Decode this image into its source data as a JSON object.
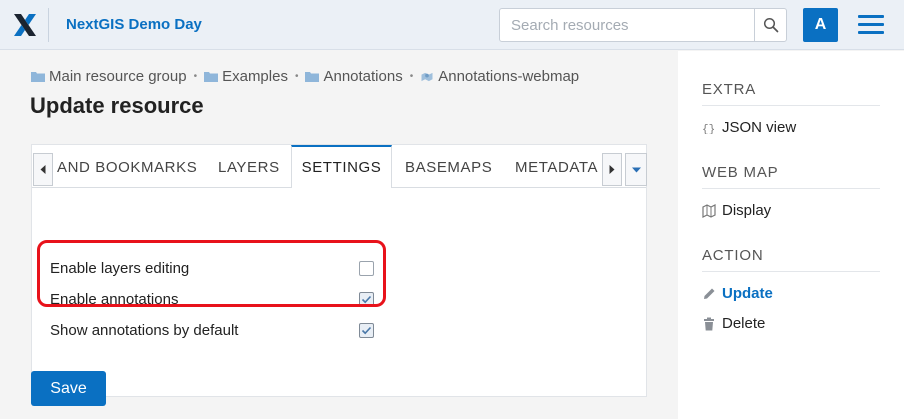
{
  "header": {
    "app_title": "NextGIS Demo Day",
    "search_placeholder": "Search resources",
    "avatar_letter": "A"
  },
  "breadcrumb": [
    {
      "label": "Main resource group",
      "icon": "folder-icon"
    },
    {
      "label": "Examples",
      "icon": "folder-icon"
    },
    {
      "label": "Annotations",
      "icon": "folder-icon"
    },
    {
      "label": "Annotations-webmap",
      "icon": "webmap-icon"
    }
  ],
  "page_title": "Update resource",
  "tabs": [
    {
      "label": "AND BOOKMARKS",
      "active": false
    },
    {
      "label": "LAYERS",
      "active": false
    },
    {
      "label": "SETTINGS",
      "active": true
    },
    {
      "label": "BASEMAPS",
      "active": false
    },
    {
      "label": "METADATA",
      "active": false
    }
  ],
  "settings": [
    {
      "label": "Enable layers editing",
      "checked": false
    },
    {
      "label": "Enable annotations",
      "checked": true
    },
    {
      "label": "Show annotations by default",
      "checked": true
    }
  ],
  "save_label": "Save",
  "sidebar": {
    "sections": [
      {
        "title": "EXTRA",
        "items": [
          {
            "label": "JSON view",
            "icon": "json-icon"
          }
        ]
      },
      {
        "title": "WEB MAP",
        "items": [
          {
            "label": "Display",
            "icon": "map-icon"
          }
        ]
      },
      {
        "title": "ACTION",
        "items": [
          {
            "label": "Update",
            "icon": "pencil-icon",
            "active": true
          },
          {
            "label": "Delete",
            "icon": "trash-icon"
          }
        ]
      }
    ]
  },
  "colors": {
    "accent": "#0a70c2",
    "highlight": "#e8121b"
  }
}
